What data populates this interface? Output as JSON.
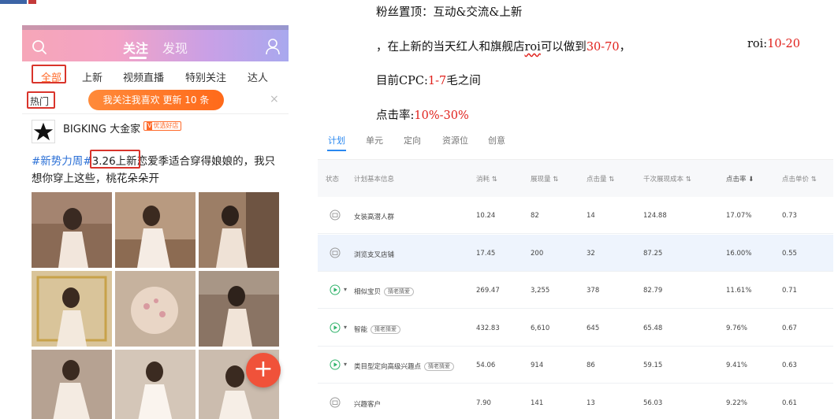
{
  "phone": {
    "header_tabs": [
      "关注",
      "发现"
    ],
    "sub_tabs": [
      "全部",
      "上新",
      "视频直播",
      "特别关注",
      "达人"
    ],
    "hot_label": "热门",
    "refresh_banner": "我关注我喜欢 更新 10 条",
    "close_glyph": "×",
    "post": {
      "author": "BIGKING 大金家",
      "verified_mark": "V",
      "verified_text": "优选好店",
      "text_tag": "#新势力周#",
      "text_date": "3.26上新",
      "text_rest": "恋爱季适合穿得娘娘的，我只想你穿上这些，桃花朵朵开"
    },
    "fab_glyph": "+",
    "accent_color": "#ff6a2a"
  },
  "notes": {
    "line1": "粉丝置顶：互动&交流&上新",
    "line2_prefix": "，在上新的当天红人和旗舰店",
    "line2_roi": "roi",
    "line2_mid": "可以做到",
    "line2_range": "30-70",
    "line2_suffix": "，",
    "line2_right_label": "roi:",
    "line2_right_range": "10-20",
    "line3_label": "目前CPC:",
    "line3_range": "1-7",
    "line3_suffix": "毛之间",
    "line4_label": "点击率:",
    "line4_range": "10%-30%",
    "highlight_color": "#e0201b"
  },
  "dashboard": {
    "tabs": [
      "计划",
      "单元",
      "定向",
      "资源位",
      "创意"
    ],
    "columns": [
      "状态",
      "计划基本信息",
      "消耗 ⇅",
      "展现量 ⇅",
      "点击量 ⇅",
      "千次展现成本 ⇅",
      "点击率 ⬇",
      "点击单价 ⇅"
    ],
    "rows": [
      {
        "name": "女装高潜人群",
        "badge": "",
        "spend": "10.24",
        "impressions": "82",
        "clicks": "14",
        "cpm": "124.88",
        "ctr": "17.07%",
        "cpc": "0.73",
        "status": "paused"
      },
      {
        "name": "浏览支叉店铺",
        "badge": "",
        "spend": "17.45",
        "impressions": "200",
        "clicks": "32",
        "cpm": "87.25",
        "ctr": "16.00%",
        "cpc": "0.55",
        "status": "paused"
      },
      {
        "name": "相似宝贝",
        "badge": "猜老猜爱",
        "spend": "269.47",
        "impressions": "3,255",
        "clicks": "378",
        "cpm": "82.79",
        "ctr": "11.61%",
        "cpc": "0.71",
        "status": "active"
      },
      {
        "name": "智能",
        "badge": "猜老猜爱",
        "spend": "432.83",
        "impressions": "6,610",
        "clicks": "645",
        "cpm": "65.48",
        "ctr": "9.76%",
        "cpc": "0.67",
        "status": "active"
      },
      {
        "name": "类目型定向高级兴趣点",
        "badge": "猜老猜爱",
        "spend": "54.06",
        "impressions": "914",
        "clicks": "86",
        "cpm": "59.15",
        "ctr": "9.41%",
        "cpc": "0.63",
        "status": "active"
      },
      {
        "name": "兴趣客户",
        "badge": "",
        "spend": "7.90",
        "impressions": "141",
        "clicks": "13",
        "cpm": "56.03",
        "ctr": "9.22%",
        "cpc": "0.61",
        "status": "paused"
      }
    ],
    "accent_color": "#2a88f0",
    "active_status_color": "#2fb36a"
  }
}
